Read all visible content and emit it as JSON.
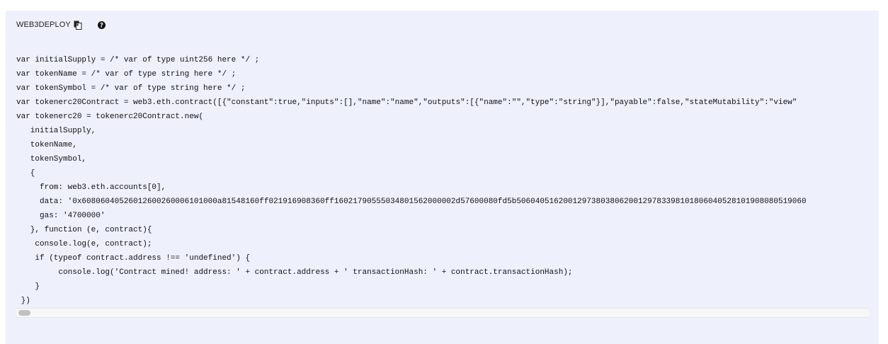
{
  "header": {
    "title": "WEB3DEPLOY",
    "copy_icon": "clipboard-icon",
    "help_icon": "question-circle-icon"
  },
  "code": {
    "lines": [
      "var initialSupply = /* var of type uint256 here */ ;",
      "var tokenName = /* var of type string here */ ;",
      "var tokenSymbol = /* var of type string here */ ;",
      "var tokenerc20Contract = web3.eth.contract([{\"constant\":true,\"inputs\":[],\"name\":\"name\",\"outputs\":[{\"name\":\"\",\"type\":\"string\"}],\"payable\":false,\"stateMutability\":\"view\"",
      "var tokenerc20 = tokenerc20Contract.new(",
      "   initialSupply,",
      "   tokenName,",
      "   tokenSymbol,",
      "   {",
      "     from: web3.eth.accounts[0],",
      "     data: '0x60806040526012600260006101000a81548160ff021916908360ff16021790555034801562000002d57600080fd5b50604051620012973803806200129783398101806040528101908080519060",
      "     gas: '4700000'",
      "   }, function (e, contract){",
      "    console.log(e, contract);",
      "    if (typeof contract.address !== 'undefined') {",
      "         console.log('Contract mined! address: ' + contract.address + ' transactionHash: ' + contract.transactionHash);",
      "    }",
      " })"
    ]
  },
  "colors": {
    "panel_bg": "#eef0fc",
    "text": "#111111",
    "scroll_thumb": "#c1c1c1"
  }
}
